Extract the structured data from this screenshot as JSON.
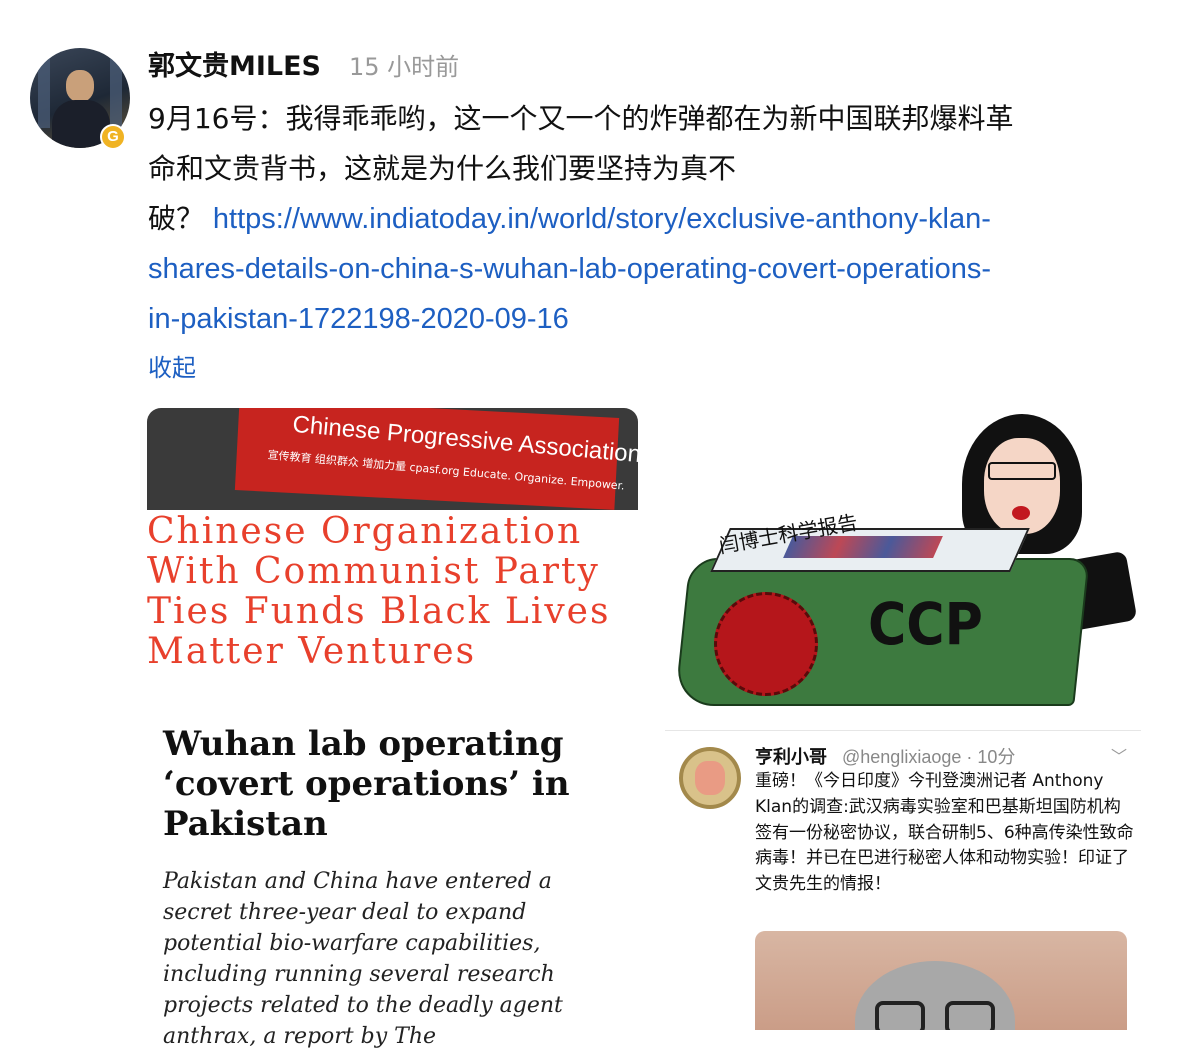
{
  "post": {
    "author": "郭文贵MILES",
    "time": "15 小时前",
    "badge": "G",
    "text_line1": "9月16号：我得乖乖哟，这一个又一个的炸弹都在为新中国联邦爆料革",
    "text_line2": "命和文贵背书，这就是为什么我们要坚持为真不",
    "text_line3": "破？",
    "link_line1": "https://www.indiatoday.in/world/story/exclusive-anthony-klan-",
    "link_line2": "shares-details-on-china-s-wuhan-lab-operating-covert-operations-",
    "link_line3": "in-pakistan-1722198-2020-09-16",
    "collapse_label": "收起"
  },
  "image1": {
    "banner_text": "Chinese Progressive Association",
    "banner_subtext": "宣传教育   组织群众   增加力量   cpasf.org   Educate. Organize. Empower.",
    "headline": "Chinese Organization With Communist Party Ties Funds Black Lives Matter Ventures"
  },
  "image2": {
    "lid_label": "闫博士科学报告",
    "coffin_text": "CCP"
  },
  "image3": {
    "headline": "Wuhan lab operating ‘covert operations’ in Pakistan",
    "body": "Pakistan and China have entered a secret three-year deal to expand potential bio-warfare capabilities, including running several research projects related to the deadly agent anthrax, a report by The"
  },
  "image4": {
    "name": "亨利小哥",
    "handle": "@henglixiaoge · 10分",
    "body": "重磅！《今日印度》今刊登澳洲记者 Anthony Klan的调查:武汉病毒实验室和巴基斯坦国防机构签有一份秘密协议，联合研制5、6种高传染性致命病毒！并已在巴进行秘密人体和动物实验！印证了文贵先生的情报！"
  }
}
